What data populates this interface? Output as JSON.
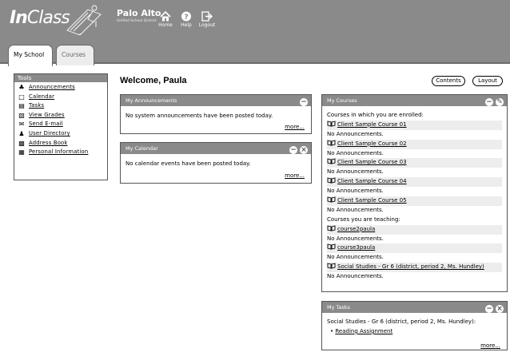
{
  "brand": {
    "logo_in": "In",
    "logo_class": "Class",
    "district_name": "Palo Alto",
    "district_sub": "Unified School District"
  },
  "nav": [
    {
      "label": "Home",
      "icon": "home-icon"
    },
    {
      "label": "Help",
      "icon": "help-icon"
    },
    {
      "label": "Logout",
      "icon": "logout-icon"
    }
  ],
  "tabs": [
    {
      "label": "My School",
      "active": true
    },
    {
      "label": "Courses",
      "active": false
    }
  ],
  "tools": {
    "title": "Tools",
    "items": [
      {
        "label": "Announcements",
        "icon": "announcement-icon"
      },
      {
        "label": "Calendar",
        "icon": "calendar-icon"
      },
      {
        "label": "Tasks",
        "icon": "tasks-icon"
      },
      {
        "label": "View Grades",
        "icon": "grades-icon"
      },
      {
        "label": "Send E-mail",
        "icon": "email-icon"
      },
      {
        "label": "User Directory",
        "icon": "user-directory-icon"
      },
      {
        "label": "Address Book",
        "icon": "address-book-icon"
      },
      {
        "label": "Personal Information",
        "icon": "personal-info-icon"
      }
    ]
  },
  "welcome": "Welcome, Paula",
  "buttons": {
    "contents": "Contents",
    "layout": "Layout"
  },
  "announcements": {
    "title": "My Announcements",
    "text": "No system announcements have been posted today.",
    "more": "more",
    "more_suffix": "..."
  },
  "calendar": {
    "title": "My Calendar",
    "text": "No calendar events have been posted today.",
    "more": "more",
    "more_suffix": "..."
  },
  "courses": {
    "title": "My Courses",
    "enrolled_heading": "Courses in which you are enrolled:",
    "teaching_heading": "Courses you are teaching:",
    "no_ann": "No Announcements.",
    "enrolled": [
      "Client Sample Course 01",
      "Client Sample Course 02",
      "Client Sample Course 03",
      "Client Sample Course 04",
      "Client Sample Course 05"
    ],
    "teaching": [
      "course2paula",
      "course3paula",
      "Social Studies - Gr 6 (district, period 2, Ms. Hundley)"
    ]
  },
  "tasks": {
    "title": "My Tasks",
    "course": "Social Studies - Gr 6 (district, period 2, Ms. Hundley):",
    "items": [
      "Reading Assignment"
    ],
    "more": "more",
    "more_suffix": "..."
  },
  "colors": {
    "header_gray": "#8a8a8a",
    "module_header": "#8a8a8a",
    "row_highlight": "#ededed"
  }
}
